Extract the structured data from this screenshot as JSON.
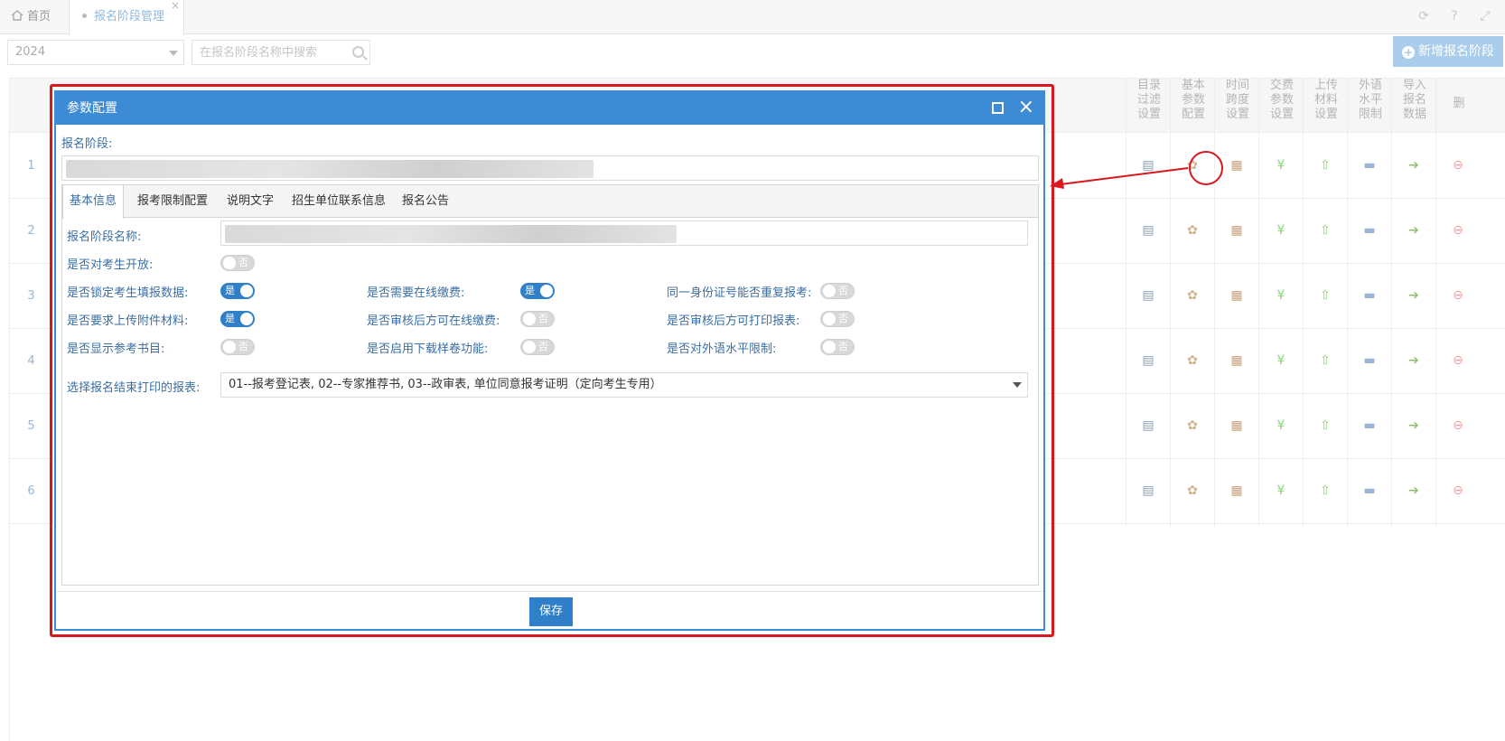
{
  "tabs": {
    "home_label": "首页",
    "active_label": "报名阶段管理",
    "close_glyph": "×"
  },
  "toolbar": {
    "year_value": "2024",
    "search_placeholder": "在报名阶段名称中搜索",
    "add_button_label": "新增报名阶段",
    "add_icon": "plus-circle-icon"
  },
  "top_right_icons": [
    "refresh-icon",
    "help-icon",
    "fullscreen-icon"
  ],
  "grid": {
    "column_headers": [
      "目录过滤设置",
      "基本参数配置",
      "时间跨度设置",
      "交费参数设置",
      "上传材料设置",
      "外语水平限制",
      "导入报名数据",
      "删"
    ],
    "column_icons": [
      "catalog-filter-icon",
      "gear-icon",
      "calendar-icon",
      "yen-icon",
      "upload-arrow-icon",
      "language-limit-icon",
      "import-icon",
      "delete-icon"
    ],
    "column_icon_colors": [
      "#8aa0b8",
      "#d2b48c",
      "#c9a07a",
      "#8fd47a",
      "#8fd47a",
      "#9bb4d8",
      "#8fbf7a",
      "#f19a9a"
    ],
    "row_numbers": [
      "1",
      "2",
      "3",
      "4",
      "5",
      "6"
    ]
  },
  "dialog": {
    "title": "参数配置",
    "stage_label": "报名阶段:",
    "tabs": [
      "基本信息",
      "报考限制配置",
      "说明文字",
      "招生单位联系信息",
      "报名公告"
    ],
    "active_tab": "基本信息",
    "fields": {
      "stage_name_label": "报名阶段名称:",
      "open_label": "是否对考生开放:",
      "lock_label": "是否锁定考生填报数据:",
      "online_pay_label": "是否需要在线缴费:",
      "repeat_id_label": "同一身份证号能否重复报考:",
      "upload_label": "是否要求上传附件材料:",
      "pay_after_review_label": "是否审核后方可在线缴费:",
      "print_after_review_label": "是否审核后方可打印报表:",
      "books_label": "是否显示参考书目:",
      "sample_download_label": "是否启用下载样卷功能:",
      "language_limit_label": "是否对外语水平限制:",
      "report_select_label": "选择报名结束打印的报表:"
    },
    "toggles": {
      "open": false,
      "lock": true,
      "online_pay": true,
      "repeat_id": false,
      "upload": true,
      "pay_after_review": false,
      "print_after_review": false,
      "books": false,
      "sample_download": false,
      "language_limit": false
    },
    "on_text": "是",
    "off_text": "否",
    "report_select_value": "01--报考登记表, 02--专家推荐书, 03--政审表, 单位同意报考证明（定向考生专用）",
    "save_label": "保存"
  },
  "colors": {
    "accent": "#3d8bd4",
    "toggle_on": "#2f7fc9",
    "annotation_red": "#d9171e"
  }
}
